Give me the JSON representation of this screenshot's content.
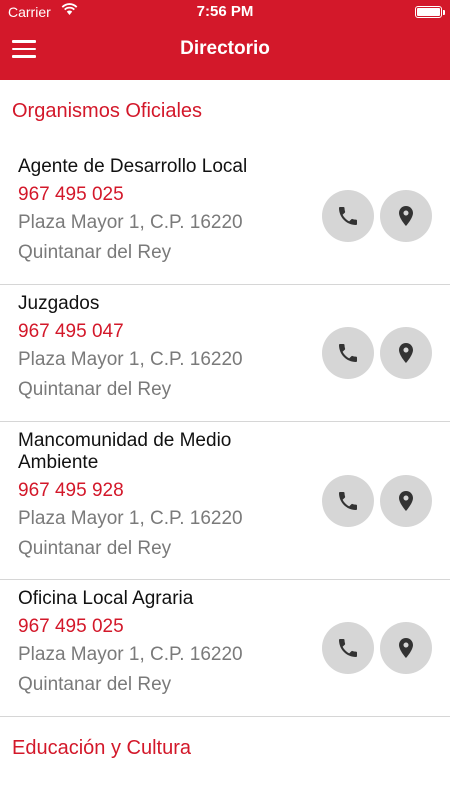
{
  "status_bar": {
    "carrier": "Carrier",
    "time": "7:56 PM",
    "battery_level": 1.0
  },
  "header": {
    "title": "Directorio",
    "menu_icon": "hamburger-menu-icon"
  },
  "sections": [
    {
      "title": "Organismos Oficiales",
      "items": [
        {
          "name": "Agente de Desarrollo Local",
          "phone": "967 495 025",
          "address": "Plaza Mayor 1, C.P. 16220",
          "city": "Quintanar del Rey"
        },
        {
          "name": "Juzgados",
          "phone": "967 495 047",
          "address": "Plaza Mayor 1, C.P. 16220",
          "city": "Quintanar del Rey"
        },
        {
          "name": "Mancomunidad de Medio Ambiente",
          "phone": "967 495 928",
          "address": "Plaza Mayor 1, C.P. 16220",
          "city": "Quintanar del Rey"
        },
        {
          "name": "Oficina Local Agraria",
          "phone": "967 495 025",
          "address": "Plaza Mayor 1, C.P. 16220",
          "city": "Quintanar del Rey"
        }
      ]
    },
    {
      "title": "Educación y Cultura"
    }
  ],
  "icons": {
    "call": "phone-icon",
    "location": "map-pin-icon"
  },
  "colors": {
    "brand": "#d3182a",
    "secondary_text": "#7a7a7a",
    "button_bg": "#d6d6d6"
  }
}
